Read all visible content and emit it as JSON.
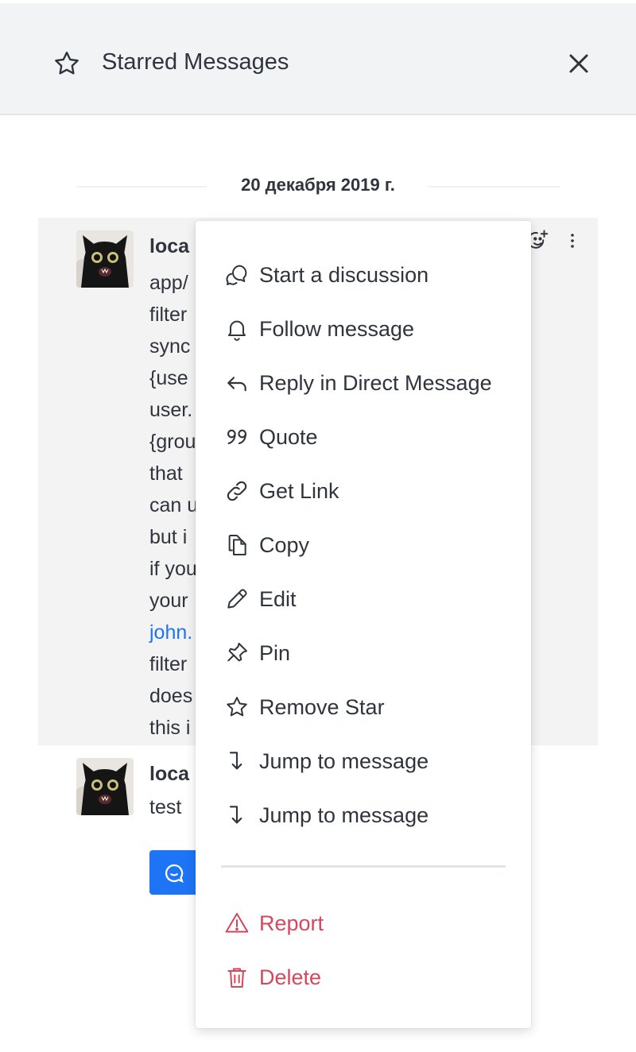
{
  "header": {
    "title": "Starred Messages",
    "icon": "star-icon",
    "close_icon": "close-icon"
  },
  "date_divider": "20 декабря 2019 г.",
  "messages": [
    {
      "author_partial": "loca",
      "lines": [
        "app/",
        "filter",
        "sync",
        "{use",
        "user.",
        "{grou",
        "that",
        "can u",
        "but i",
        "if you",
        "your",
        "john.",
        "filter",
        "does",
        "this i"
      ],
      "link_line_index": 11
    },
    {
      "author_partial": "loca",
      "text": "test",
      "thread_icon": "discussion-icon"
    }
  ],
  "context_menu": {
    "items": [
      {
        "label": "Start a discussion",
        "icon": "discussion-icon"
      },
      {
        "label": "Follow message",
        "icon": "bell-icon"
      },
      {
        "label": "Reply in Direct Message",
        "icon": "reply-icon"
      },
      {
        "label": "Quote",
        "icon": "quote-icon"
      },
      {
        "label": "Get Link",
        "icon": "link-icon"
      },
      {
        "label": "Copy",
        "icon": "copy-icon"
      },
      {
        "label": "Edit",
        "icon": "pencil-icon"
      },
      {
        "label": "Pin",
        "icon": "pin-icon"
      },
      {
        "label": "Remove Star",
        "icon": "star-icon"
      },
      {
        "label": "Jump to message",
        "icon": "jump-icon"
      },
      {
        "label": "Jump to message",
        "icon": "jump-icon"
      }
    ],
    "danger_items": [
      {
        "label": "Report",
        "icon": "warning-icon"
      },
      {
        "label": "Delete",
        "icon": "trash-icon"
      }
    ]
  },
  "colors": {
    "accent": "#1d74f5",
    "danger": "#d4475c",
    "text": "#2f343d",
    "header_bg": "#f2f3f5"
  }
}
